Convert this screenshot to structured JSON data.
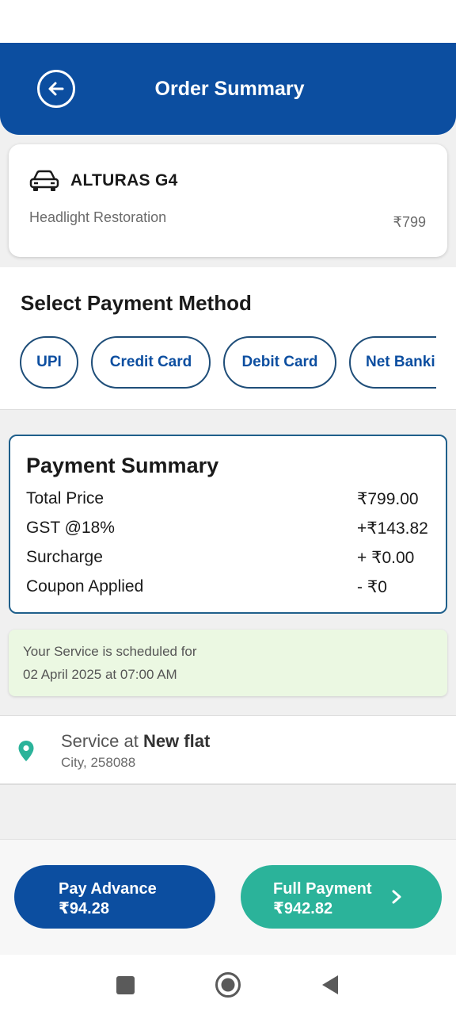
{
  "header": {
    "title": "Order Summary"
  },
  "vehicle": {
    "name": "ALTURAS G4",
    "service": "Headlight Restoration",
    "price": "₹799"
  },
  "payment_method": {
    "title": "Select Payment Method",
    "options": [
      "UPI",
      "Credit Card",
      "Debit Card",
      "Net Banking"
    ]
  },
  "payment_summary": {
    "title": "Payment Summary",
    "rows": [
      {
        "label": "Total Price",
        "value": "₹799.00"
      },
      {
        "label": "GST @18%",
        "value": "+₹143.82"
      },
      {
        "label": "Surcharge",
        "value": "+ ₹0.00"
      },
      {
        "label": "Coupon Applied",
        "value": "- ₹0"
      }
    ]
  },
  "schedule": {
    "line1": "Your Service is scheduled for",
    "line2": "02 April 2025 at 07:00 AM"
  },
  "address": {
    "prefix": "Service at ",
    "name": "New flat",
    "detail": "City, 258088"
  },
  "actions": {
    "advance": {
      "label": "Pay Advance",
      "amount": "₹94.28"
    },
    "full": {
      "label": "Full Payment",
      "amount": "₹942.82"
    }
  },
  "colors": {
    "primary": "#0c4ea0",
    "accent": "#2bb39a",
    "schedule_bg": "#ebf8e2"
  },
  "icons": [
    "back-arrow-icon",
    "car-icon",
    "location-pin-icon",
    "chevron-right-icon",
    "recents-icon",
    "home-icon",
    "back-icon"
  ]
}
